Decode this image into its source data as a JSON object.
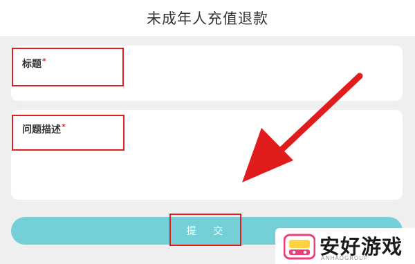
{
  "header": {
    "title": "未成年人充值退款"
  },
  "form": {
    "title_field": {
      "label": "标题",
      "required_mark": "*"
    },
    "description_field": {
      "label": "问题描述",
      "required_mark": "*"
    },
    "submit_label": "提 交"
  },
  "watermark": {
    "name": "安好游戏",
    "subtitle": "ANHAOGROUP"
  },
  "colors": {
    "accent": "#74d0d6",
    "annotation_red": "#e01c1c",
    "background": "#efefef",
    "required": "#e02424"
  }
}
